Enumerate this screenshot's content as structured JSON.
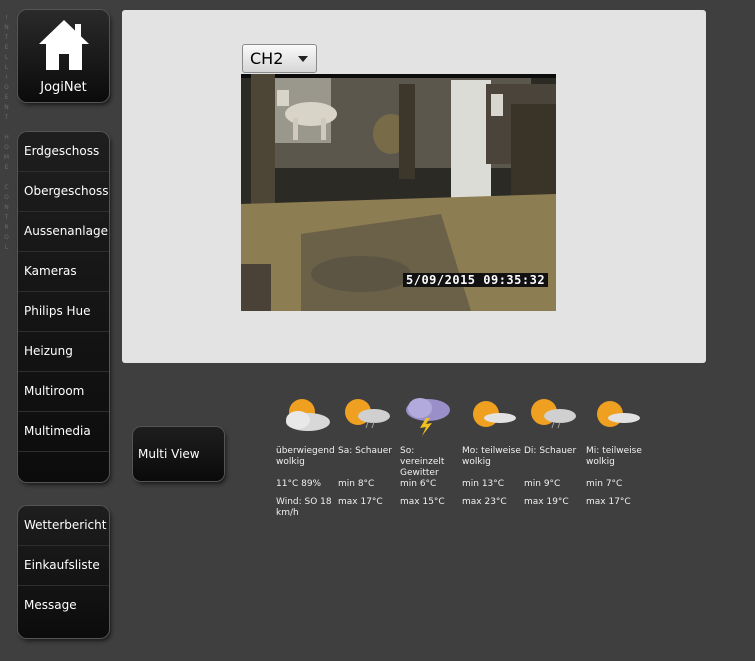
{
  "brand": {
    "vertical_text": "INTELLIGENT HOME CONTROL",
    "logo_label": "JogiNet"
  },
  "menu_main": [
    {
      "label": "Erdgeschoss"
    },
    {
      "label": "Obergeschoss"
    },
    {
      "label": "Aussenanlage"
    },
    {
      "label": "Kameras"
    },
    {
      "label": "Philips Hue"
    },
    {
      "label": "Heizung"
    },
    {
      "label": "Multiroom"
    },
    {
      "label": "Multimedia"
    }
  ],
  "menu_secondary": [
    {
      "label": "Wetterbericht"
    },
    {
      "label": "Einkaufsliste"
    },
    {
      "label": "Message"
    }
  ],
  "camera": {
    "channel": "CH2",
    "timestamp": "5/09/2015 09:35:32"
  },
  "multiview_label": "Multi View",
  "weather": [
    {
      "condition": "überwiegend wolkig",
      "temp": "11°C 89%",
      "wind": "Wind: SO 18 km/h",
      "icon": "cloudy-sun-icon"
    },
    {
      "condition": "Sa: Schauer",
      "min": "min 8°C",
      "max": "max 17°C",
      "icon": "sun-cloud-icon"
    },
    {
      "condition": "So: vereinzelt Gewitter",
      "min": "min 6°C",
      "max": "max 15°C",
      "icon": "thunderstorm-icon"
    },
    {
      "condition": "Mo: teilweise wolkig",
      "min": "min 13°C",
      "max": "max 23°C",
      "icon": "partly-cloudy-icon"
    },
    {
      "condition": "Di: Schauer",
      "min": "min 9°C",
      "max": "max 19°C",
      "icon": "sun-cloud-icon"
    },
    {
      "condition": "Mi: teilweise wolkig",
      "min": "min 7°C",
      "max": "max 17°C",
      "icon": "partly-cloudy-icon"
    }
  ]
}
